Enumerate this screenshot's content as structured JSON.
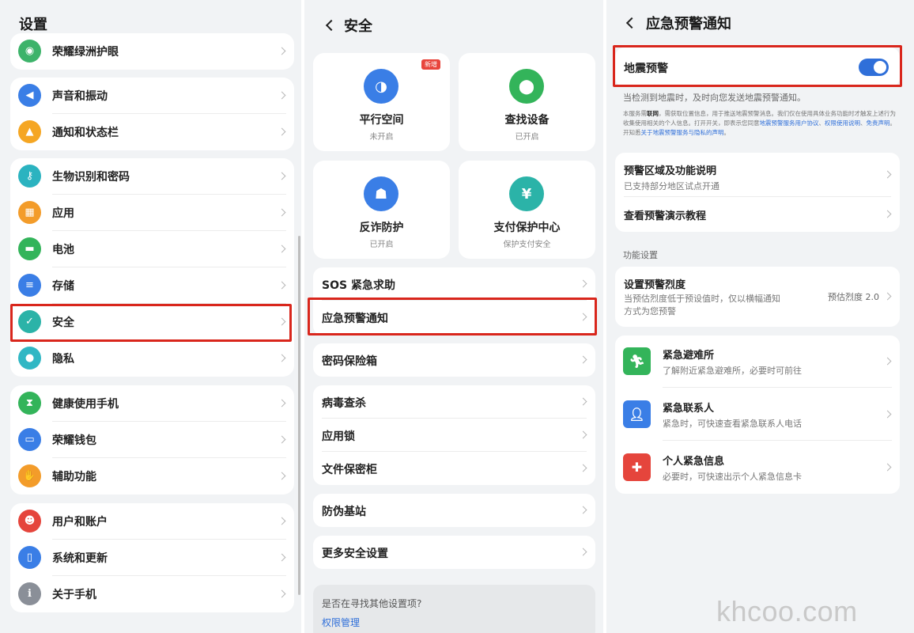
{
  "panel1": {
    "title": "设置",
    "groups": [
      [
        {
          "label": "荣耀绿洲护眼",
          "icon": "eye-comfort-icon",
          "color": "#3db36a"
        }
      ],
      [
        {
          "label": "声音和振动",
          "icon": "sound-icon",
          "color": "#3a7ee6"
        },
        {
          "label": "通知和状态栏",
          "icon": "bell-icon",
          "color": "#f5a623"
        }
      ],
      [
        {
          "label": "生物识别和密码",
          "icon": "key-icon",
          "color": "#2bb3c0"
        },
        {
          "label": "应用",
          "icon": "apps-icon",
          "color": "#f39c2a"
        },
        {
          "label": "电池",
          "icon": "battery-icon",
          "color": "#33b45a"
        },
        {
          "label": "存储",
          "icon": "storage-icon",
          "color": "#3a7ee6"
        },
        {
          "label": "安全",
          "icon": "shield-icon",
          "color": "#2bb3a8"
        },
        {
          "label": "隐私",
          "icon": "privacy-icon",
          "color": "#30b7c4"
        }
      ],
      [
        {
          "label": "健康使用手机",
          "icon": "hourglass-icon",
          "color": "#33b45a"
        },
        {
          "label": "荣耀钱包",
          "icon": "wallet-icon",
          "color": "#3a7ee6"
        },
        {
          "label": "辅助功能",
          "icon": "hand-icon",
          "color": "#f39c2a"
        }
      ],
      [
        {
          "label": "用户和账户",
          "icon": "user-icon",
          "color": "#e5453c"
        },
        {
          "label": "系统和更新",
          "icon": "system-update-icon",
          "color": "#3a7ee6"
        },
        {
          "label": "关于手机",
          "icon": "phone-info-icon",
          "color": "#8a8f98"
        }
      ]
    ]
  },
  "panel2": {
    "title": "安全",
    "cards": [
      {
        "title": "平行空间",
        "status": "未开启",
        "badge": "新增",
        "icon": "parallel-space-icon",
        "color": "#3a7ee6"
      },
      {
        "title": "查找设备",
        "status": "已开启",
        "badge": "",
        "icon": "location-pin-icon",
        "color": "#33b45a"
      },
      {
        "title": "反诈防护",
        "status": "已开启",
        "badge": "",
        "icon": "anti-fraud-icon",
        "color": "#3a7ee6"
      },
      {
        "title": "支付保护中心",
        "status": "保护支付安全",
        "badge": "",
        "icon": "payment-shield-icon",
        "color": "#2bb3a8"
      }
    ],
    "groups": [
      [
        "SOS 紧急求助",
        "应急预警通知"
      ],
      [
        "密码保险箱"
      ],
      [
        "病毒查杀",
        "应用锁",
        "文件保密柜"
      ],
      [
        "防伪基站"
      ],
      [
        "更多安全设置"
      ]
    ],
    "hint_question": "是否在寻找其他设置项?",
    "hint_link": "权限管理"
  },
  "panel3": {
    "title": "应急预警通知",
    "toggle_label": "地震预警",
    "toggle_on": true,
    "desc": "当检测到地震时，及时向您发送地震预警通知。",
    "fine1": "本服务需",
    "fine_bold": "联网",
    "fine2": "，需获取位置信息，用于推送地震预警消息。我们仅在使用具体业务功能时才触发上述行为收集使用相关的个人信息。打开开关，即表示您同意",
    "fine_link1": "地震预警服务用户协议",
    "fine_sep": "、",
    "fine_link2": "权限使用说明",
    "fine_link3": "免责声明",
    "fine3": "。开知悉",
    "fine_link4": "关于地震预警服务与隐私的声明",
    "fine_end": "。",
    "info_rows": [
      {
        "title": "预警区域及功能说明",
        "sub": "已支持部分地区试点开通"
      },
      {
        "title": "查看预警演示教程",
        "sub": ""
      }
    ],
    "section_label": "功能设置",
    "intensity": {
      "title": "设置预警烈度",
      "sub": "当预估烈度低于预设值时，仅以横幅通知方式为您预警",
      "value": "预估烈度 2.0"
    },
    "emergency": [
      {
        "title": "紧急避难所",
        "sub": "了解附近紧急避难所，必要时可前往",
        "icon": "running-person-icon",
        "color": "#33b45a"
      },
      {
        "title": "紧急联系人",
        "sub": "紧急时，可快速查看紧急联系人电话",
        "icon": "contact-person-icon",
        "color": "#3a7ee6"
      },
      {
        "title": "个人紧急信息",
        "sub": "必要时，可快速出示个人紧急信息卡",
        "icon": "medical-cross-icon",
        "color": "#e5453c"
      }
    ]
  },
  "watermark": "khcoo.com"
}
